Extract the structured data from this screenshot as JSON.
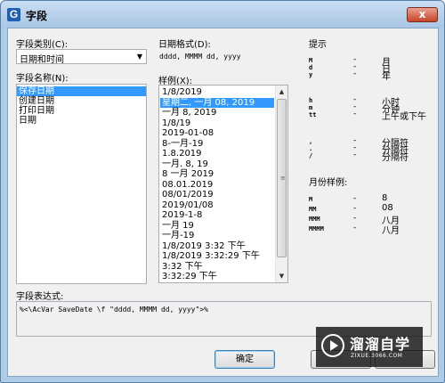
{
  "window": {
    "title": "字段",
    "app_icon_glyph": "G",
    "close_glyph": "x"
  },
  "category": {
    "label": "字段类别(C):",
    "selected": "日期和时间"
  },
  "field_names": {
    "label": "字段名称(N):",
    "items": [
      "保存日期",
      "创建日期",
      "打印日期",
      "日期"
    ],
    "selected_index": 0
  },
  "date_format": {
    "label": "日期格式(D):",
    "value": "dddd, MMMM dd, yyyy"
  },
  "sample": {
    "label": "样例(X):",
    "items": [
      "1/8/2019",
      "星期二, 一月 08, 2019",
      "一月 8, 2019",
      "1/8/19",
      "2019-01-08",
      "8-一月-19",
      "1.8.2019",
      "一月. 8, 19",
      "8 一月 2019",
      "08.01.2019",
      "08/01/2019",
      "2019/01/08",
      "2019-1-8",
      "一月 19",
      "一月-19",
      "1/8/2019 3:32 下午",
      "1/8/2019 3:32:29 下午",
      "3:32 下午",
      "3:32:29 下午"
    ],
    "selected_index": 1
  },
  "hints": {
    "title": "提示",
    "rows": [
      {
        "code": "M",
        "desc": "月"
      },
      {
        "code": "d",
        "desc": "日"
      },
      {
        "code": "y",
        "desc": "年"
      },
      {
        "code": "h",
        "desc": "小时"
      },
      {
        "code": "m",
        "desc": "分钟"
      },
      {
        "code": "tt",
        "desc": "上午或下午"
      },
      {
        "code": ",",
        "desc": "分隔符"
      },
      {
        "code": ".",
        "desc": "分隔符"
      },
      {
        "code": "/",
        "desc": "分隔符"
      }
    ],
    "dash": "-",
    "month_title": "月份样例:",
    "month_rows": [
      {
        "code": "M",
        "desc": "8"
      },
      {
        "code": "MM",
        "desc": "08"
      },
      {
        "code": "MMM",
        "desc": "八月"
      },
      {
        "code": "MMMM",
        "desc": "八月"
      }
    ]
  },
  "expression": {
    "label": "字段表达式:",
    "value": "%<\\AcVar SaveDate \\f \"dddd, MMMM dd, yyyy\">%"
  },
  "buttons": {
    "ok": "确定"
  },
  "watermark": {
    "name": "溜溜自学",
    "url": "ZIXUE.3066.COM"
  },
  "colors": {
    "selection": "#3399ff",
    "frame": "#aecbe8",
    "client": "#f0f0f0",
    "close": "#c8452a"
  }
}
